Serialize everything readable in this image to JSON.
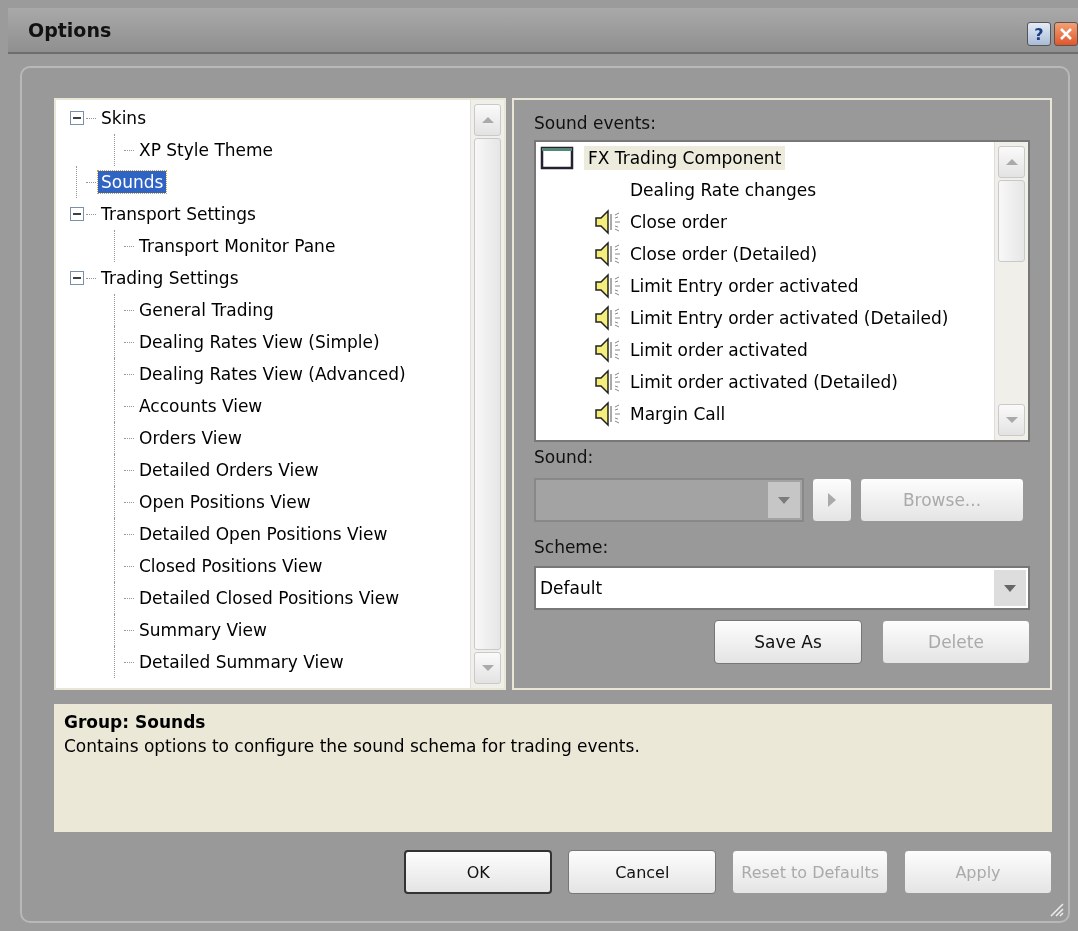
{
  "window": {
    "title": "Options",
    "help": "?"
  },
  "tree": [
    {
      "label": "Skins",
      "expanded": true,
      "selected": false,
      "children": [
        {
          "label": "XP Style Theme",
          "selected": false
        }
      ]
    },
    {
      "label": "Sounds",
      "selected": true
    },
    {
      "label": "Transport Settings",
      "expanded": true,
      "selected": false,
      "children": [
        {
          "label": "Transport Monitor Pane",
          "selected": false
        }
      ]
    },
    {
      "label": "Trading Settings",
      "expanded": true,
      "selected": false,
      "children": [
        {
          "label": "General Trading",
          "selected": false
        },
        {
          "label": "Dealing Rates View (Simple)",
          "selected": false
        },
        {
          "label": "Dealing Rates View (Advanced)",
          "selected": false
        },
        {
          "label": "Accounts View",
          "selected": false
        },
        {
          "label": "Orders View",
          "selected": false
        },
        {
          "label": "Detailed Orders View",
          "selected": false
        },
        {
          "label": "Open Positions View",
          "selected": false
        },
        {
          "label": "Detailed Open Positions View",
          "selected": false
        },
        {
          "label": "Closed Positions View",
          "selected": false
        },
        {
          "label": "Detailed Closed Positions View",
          "selected": false
        },
        {
          "label": "Summary View",
          "selected": false
        },
        {
          "label": "Detailed Summary View",
          "selected": false
        }
      ]
    }
  ],
  "sound_events": {
    "label": "Sound events:",
    "root": {
      "label": "FX Trading Component",
      "highlighted": true
    },
    "items": [
      {
        "label": "Dealing Rate changes",
        "kind": "plain"
      },
      {
        "label": "Close order",
        "kind": "sound"
      },
      {
        "label": "Close order (Detailed)",
        "kind": "sound"
      },
      {
        "label": "Limit Entry order activated",
        "kind": "sound"
      },
      {
        "label": "Limit Entry order activated (Detailed)",
        "kind": "sound"
      },
      {
        "label": "Limit order activated",
        "kind": "sound"
      },
      {
        "label": "Limit order activated (Detailed)",
        "kind": "sound"
      },
      {
        "label": "Margin Call",
        "kind": "sound"
      }
    ]
  },
  "sound": {
    "label": "Sound:",
    "disabled": true
  },
  "play_button": {
    "disabled": true
  },
  "browse_button": {
    "label": "Browse...",
    "disabled": true
  },
  "scheme": {
    "label": "Scheme:",
    "value": "Default"
  },
  "scheme_buttons": [
    {
      "label": "Save As",
      "disabled": false
    },
    {
      "label": "Delete",
      "disabled": true
    }
  ],
  "description": {
    "title": "Group: Sounds",
    "text": "Contains options to configure the sound schema for trading events."
  },
  "buttons": [
    {
      "label": "OK",
      "default": true,
      "disabled": false
    },
    {
      "label": "Cancel",
      "default": false,
      "disabled": false
    },
    {
      "label": "Reset to Defaults",
      "default": false,
      "disabled": true
    },
    {
      "label": "Apply",
      "default": false,
      "disabled": true
    }
  ]
}
